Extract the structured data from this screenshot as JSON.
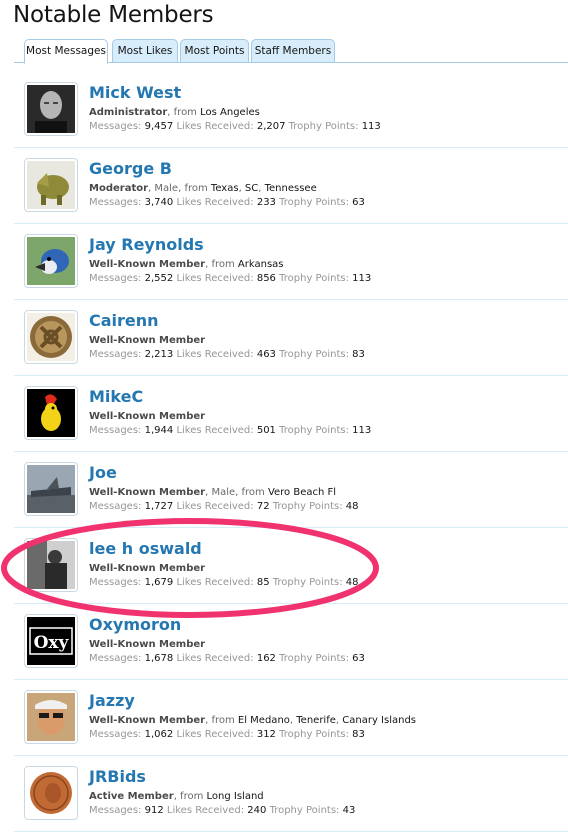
{
  "page": {
    "title": "Notable Members"
  },
  "tabs": [
    {
      "label": "Most Messages",
      "active": true
    },
    {
      "label": "Most Likes",
      "active": false
    },
    {
      "label": "Most Points",
      "active": false
    },
    {
      "label": "Staff Members",
      "active": false
    }
  ],
  "stat_labels": {
    "messages": "Messages:",
    "likes": "Likes Received:",
    "points": "Trophy Points:"
  },
  "members": [
    {
      "name": "Mick West",
      "title": "Administrator",
      "gender": "",
      "location": "Los Angeles",
      "messages": "9,457",
      "likes": "2,207",
      "points": "113",
      "avatar": "bald-man-portrait"
    },
    {
      "name": "George B",
      "title": "Moderator",
      "gender": "Male",
      "location_parts": [
        "Texas",
        "SC",
        "Tennessee"
      ],
      "messages": "3,740",
      "likes": "233",
      "points": "63",
      "avatar": "triceratops"
    },
    {
      "name": "Jay Reynolds",
      "title": "Well-Known Member",
      "gender": "",
      "location": "Arkansas",
      "messages": "2,552",
      "likes": "856",
      "points": "113",
      "avatar": "blue-jay"
    },
    {
      "name": "Cairenn",
      "title": "Well-Known Member",
      "gender": "",
      "location": "",
      "messages": "2,213",
      "likes": "463",
      "points": "83",
      "avatar": "celtic-knot"
    },
    {
      "name": "MikeC",
      "title": "Well-Known Member",
      "gender": "",
      "location": "",
      "messages": "1,944",
      "likes": "501",
      "points": "113",
      "avatar": "cartoon-rooster"
    },
    {
      "name": "Joe",
      "title": "Well-Known Member",
      "gender": "Male",
      "location": "Vero Beach Fl",
      "messages": "1,727",
      "likes": "72",
      "points": "48",
      "avatar": "jet-aircraft"
    },
    {
      "name": "lee h oswald",
      "title": "Well-Known Member",
      "gender": "",
      "location": "",
      "messages": "1,679",
      "likes": "85",
      "points": "48",
      "avatar": "bw-photo"
    },
    {
      "name": "Oxymoron",
      "title": "Well-Known Member",
      "gender": "",
      "location": "",
      "messages": "1,678",
      "likes": "162",
      "points": "63",
      "avatar": "oxy-text",
      "avatar_text": "Oxy"
    },
    {
      "name": "Jazzy",
      "title": "Well-Known Member",
      "gender": "",
      "location_parts": [
        "El Medano",
        "Tenerife",
        "Canary Islands"
      ],
      "messages": "1,062",
      "likes": "312",
      "points": "83",
      "avatar": "man-sunglasses"
    },
    {
      "name": "JRBids",
      "title": "Active Member",
      "gender": "",
      "location": "Long Island",
      "messages": "912",
      "likes": "240",
      "points": "43",
      "avatar": "penny-coin"
    }
  ],
  "words": {
    "from": "from",
    "sep": ", "
  },
  "colors": {
    "link": "#2577b1",
    "tab_bg": "#d7edfc",
    "tab_border": "#a5cae4",
    "highlight": "#f0336e"
  }
}
